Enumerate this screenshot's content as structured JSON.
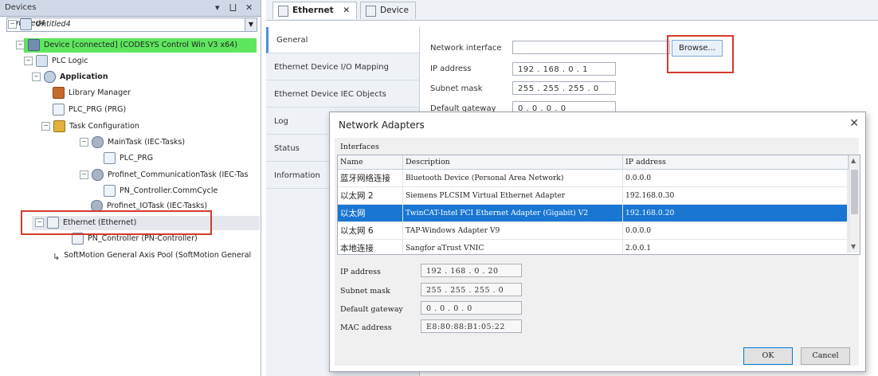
{
  "devices_panel": {
    "title": "Devices",
    "title_icons": [
      "▾",
      "⨆",
      "✕"
    ],
    "project_dropdown": "Untitled4",
    "tree": [
      {
        "label": "Untitled4",
        "icon": "project-icon",
        "toggle": "−"
      },
      {
        "label": "Device [connected] (CODESYS Control Win V3 x64)",
        "icon": "device-icon",
        "toggle": "−"
      },
      {
        "label": "PLC Logic",
        "icon": "plc-logic-icon",
        "toggle": "−"
      },
      {
        "label": "Application",
        "icon": "application-icon",
        "toggle": "−"
      },
      {
        "label": "Library Manager",
        "icon": "library-icon"
      },
      {
        "label": "PLC_PRG (PRG)",
        "icon": "program-icon"
      },
      {
        "label": "Task Configuration",
        "icon": "task-config-icon",
        "toggle": "−"
      },
      {
        "label": "MainTask (IEC-Tasks)",
        "icon": "task-icon",
        "toggle": "−"
      },
      {
        "label": "PLC_PRG",
        "icon": "program-call-icon"
      },
      {
        "label": "Profinet_CommunicationTask (IEC-Tas",
        "icon": "task-icon",
        "toggle": "−"
      },
      {
        "label": "PN_Controller.CommCycle",
        "icon": "program-call-icon"
      },
      {
        "label": "Profinet_IOTask (IEC-Tasks)",
        "icon": "task-icon"
      },
      {
        "label": "Ethernet (Ethernet)",
        "icon": "ethernet-icon",
        "toggle": "−"
      },
      {
        "label": "PN_Controller (PN-Controller)",
        "icon": "pn-controller-icon"
      },
      {
        "label": "SoftMotion General Axis Pool (SoftMotion General",
        "icon": "axis-pool-icon"
      }
    ]
  },
  "tabs": [
    {
      "label": "Ethernet",
      "close": "✕"
    },
    {
      "label": "Device"
    }
  ],
  "editor": {
    "nav": [
      "General",
      "Ethernet Device I/O Mapping",
      "Ethernet Device IEC Objects",
      "Log",
      "Status",
      "Information"
    ],
    "fields": {
      "network_interface_label": "Network interface",
      "network_interface_value": "",
      "ip_label": "IP address",
      "ip_value": "192 . 168 . 0 . 1",
      "subnet_label": "Subnet mask",
      "subnet_value": "255 . 255 . 255 . 0",
      "gateway_label": "Default gateway",
      "gateway_value": "0 . 0 . 0 . 0"
    },
    "browse_label": "Browse..."
  },
  "dialog": {
    "title": "Network Adapters",
    "close": "✕",
    "interfaces_label": "Interfaces",
    "columns": [
      "Name",
      "Description",
      "IP address"
    ],
    "rows": [
      {
        "name": "蓝牙网络连接",
        "description": "Bluetooth Device (Personal Area Network)",
        "ip": "0.0.0.0"
      },
      {
        "name": "以太网 2",
        "description": "Siemens PLCSIM Virtual Ethernet Adapter",
        "ip": "192.168.0.30"
      },
      {
        "name": "以太网",
        "description": "TwinCAT-Intel PCI Ethernet Adapter (Gigabit) V2",
        "ip": "192.168.0.20",
        "selected": true
      },
      {
        "name": "以太网 6",
        "description": "TAP-Windows Adapter V9",
        "ip": "0.0.0.0"
      },
      {
        "name": "本地连接",
        "description": "Sangfor aTrust VNIC",
        "ip": "2.0.0.1"
      }
    ],
    "details": {
      "ip_label": "IP address",
      "ip_value": "192 . 168 . 0 . 20",
      "subnet_label": "Subnet mask",
      "subnet_value": "255 . 255 . 255 . 0",
      "gateway_label": "Default gateway",
      "gateway_value": "0 . 0 . 0 . 0",
      "mac_label": "MAC address",
      "mac_value": "E8:80:88:B1:05:22"
    },
    "ok_label": "OK",
    "cancel_label": "Cancel"
  },
  "colors": {
    "highlight_connected": "#5ee65e",
    "selection_blue": "#1976d2",
    "annotation_red": "#d43a2a"
  }
}
